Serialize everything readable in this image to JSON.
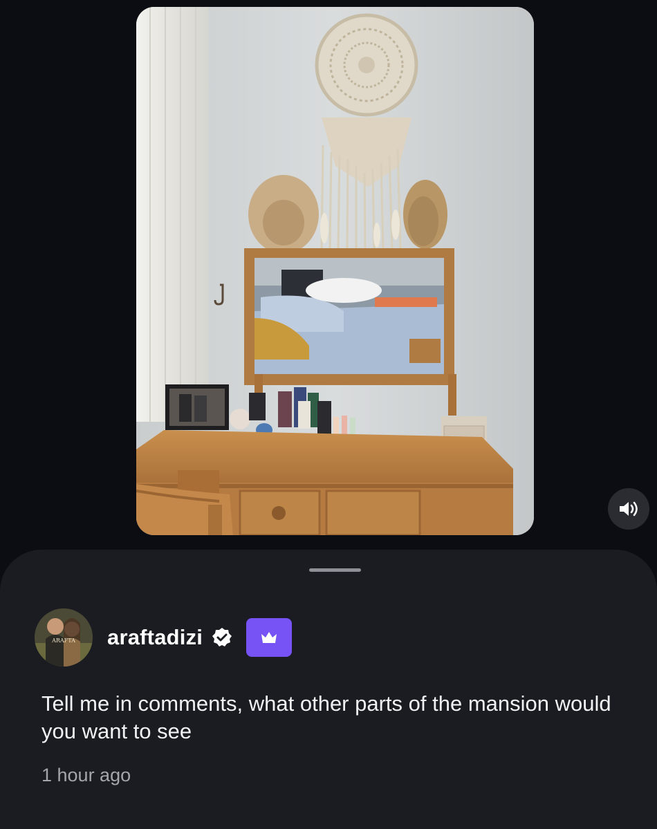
{
  "media": {
    "icon": "dressing-table-scene"
  },
  "controls": {
    "sound_icon": "speaker-on-icon"
  },
  "post": {
    "author": {
      "username": "araftadizi",
      "avatar_text": "ARAFTA",
      "verified_icon": "verified-badge-icon",
      "badge_icon": "crown-icon"
    },
    "text": "Tell me in comments, what other parts of the mansion would you want to see",
    "timestamp": "1 hour ago"
  },
  "colors": {
    "background": "#0b0d12",
    "sheet": "#1a1c21",
    "badge": "#7752f5",
    "timestamp": "#a3a6ac"
  }
}
